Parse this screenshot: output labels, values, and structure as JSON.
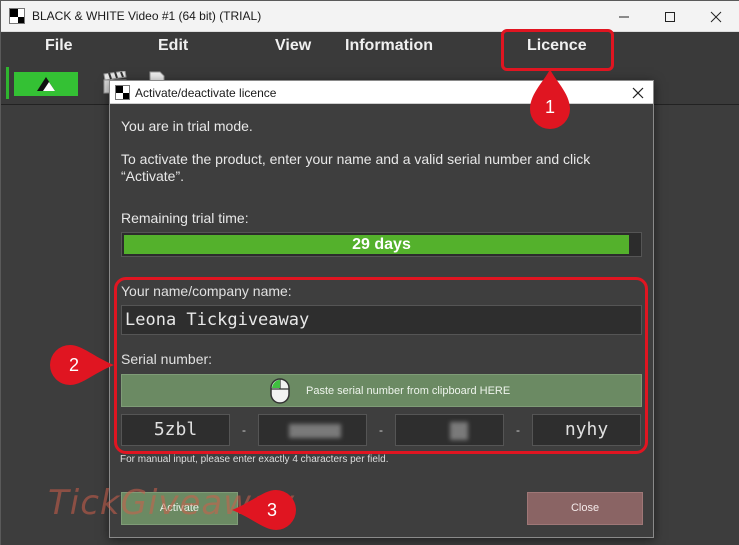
{
  "app": {
    "title": "BLACK & WHITE Video #1 (64 bit) (TRIAL)"
  },
  "menu": {
    "items": [
      "File",
      "Edit",
      "View",
      "Information",
      "Licence"
    ]
  },
  "dialog": {
    "title": "Activate/deactivate licence",
    "trial_text": "You are in trial mode.",
    "activate_info": "To activate the product, enter your name and a valid serial number and click “Activate”.",
    "remaining_label": "Remaining trial time:",
    "remaining_value": "29 days",
    "remaining_fraction": 0.98,
    "name_label": "Your name/company name:",
    "name_value": "Leona Tickgiveaway",
    "serial_label": "Serial number:",
    "paste_label": "Paste serial number from clipboard HERE",
    "serial_fields": [
      "5zbl",
      "",
      "",
      "nyhy"
    ],
    "serial_separator": "-",
    "manual_hint": "For manual input, please enter exactly 4 characters per field.",
    "activate_button": "Activate",
    "close_button": "Close"
  },
  "watermark": "TickGiveaway",
  "annotations": {
    "markers": [
      "1",
      "2",
      "3"
    ],
    "color": "#e01521"
  },
  "colors": {
    "progress": "#54b12c",
    "activate": "#6b8a63",
    "close": "#8a6464",
    "logo": "#34c134"
  }
}
